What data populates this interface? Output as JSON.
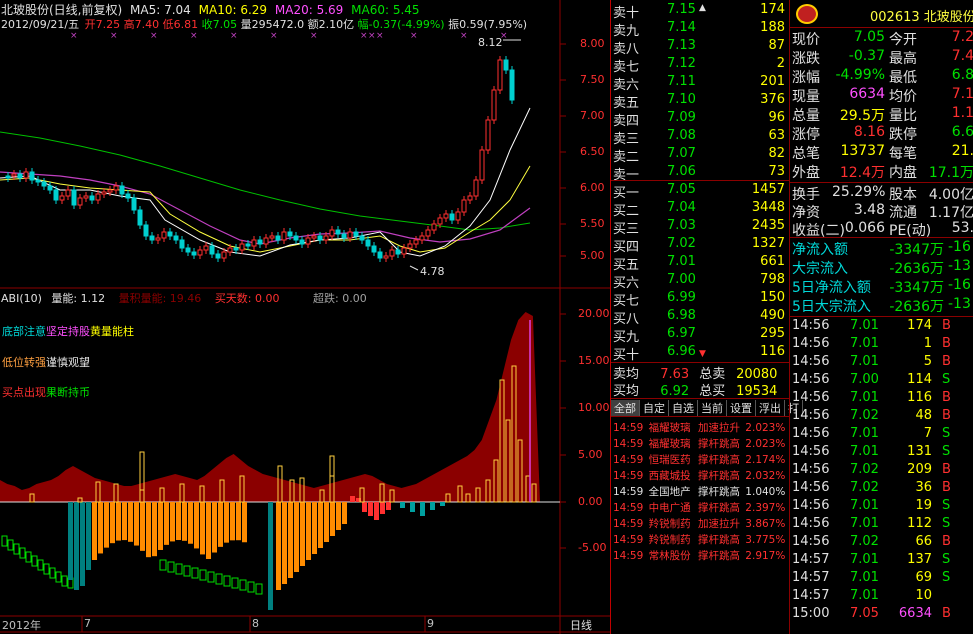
{
  "chart_header": {
    "stock": "北玻股份(日线,前复权)",
    "ma5": "MA5: 7.04",
    "ma10": "MA10: 6.29",
    "ma20": "MA20: 5.69",
    "ma60": "MA60: 5.45",
    "date_line": "2012/09/21/五",
    "open": "开7.25",
    "high": "高7.40",
    "low": "低6.81",
    "close": "收7.05",
    "vol": "量295472.0",
    "amount": "额2.10亿",
    "change": "幅-0.37(-4.99%)",
    "amplitude": "振0.59(7.95%)"
  },
  "price_axis": [
    "8.00",
    "7.50",
    "7.00",
    "6.50",
    "6.00",
    "5.50",
    "5.00"
  ],
  "high_mark": "8.12",
  "low_mark": "4.78",
  "indicator_header": {
    "name": "ABI(10)",
    "label1": "量能: 1.12",
    "label2": "量积量能: 19.46",
    "label3": "买天数: 0.00",
    "label4": "超跌: 0.00"
  },
  "indicator_axis": [
    "20.00",
    "15.00",
    "10.00",
    "5.00",
    "0.00",
    "-5.00"
  ],
  "indicator_notes": {
    "n1a": "底部注意",
    "n1b": "坚定持股",
    "n1c": "黄量能柱",
    "n2a": "低位转强",
    "n2b": "谨慎观望",
    "n3a": "买点出现",
    "n3b": "果断持币"
  },
  "time_axis": [
    "2012年",
    "7",
    "8",
    "9"
  ],
  "period_label": "日线",
  "quote_title": "002613 北玻股份",
  "sell_book": [
    {
      "label": "卖十",
      "price": "7.15",
      "vol": "174"
    },
    {
      "label": "卖九",
      "price": "7.14",
      "vol": "188"
    },
    {
      "label": "卖八",
      "price": "7.13",
      "vol": "87"
    },
    {
      "label": "卖七",
      "price": "7.12",
      "vol": "2"
    },
    {
      "label": "卖六",
      "price": "7.11",
      "vol": "201"
    },
    {
      "label": "卖五",
      "price": "7.10",
      "vol": "376"
    },
    {
      "label": "卖四",
      "price": "7.09",
      "vol": "96"
    },
    {
      "label": "卖三",
      "price": "7.08",
      "vol": "63"
    },
    {
      "label": "卖二",
      "price": "7.07",
      "vol": "82"
    },
    {
      "label": "卖一",
      "price": "7.06",
      "vol": "73"
    }
  ],
  "buy_book": [
    {
      "label": "买一",
      "price": "7.05",
      "vol": "1457"
    },
    {
      "label": "买二",
      "price": "7.04",
      "vol": "3448"
    },
    {
      "label": "买三",
      "price": "7.03",
      "vol": "2435"
    },
    {
      "label": "买四",
      "price": "7.02",
      "vol": "1327"
    },
    {
      "label": "买五",
      "price": "7.01",
      "vol": "661"
    },
    {
      "label": "买六",
      "price": "7.00",
      "vol": "798"
    },
    {
      "label": "买七",
      "price": "6.99",
      "vol": "150"
    },
    {
      "label": "买八",
      "price": "6.98",
      "vol": "490"
    },
    {
      "label": "买九",
      "price": "6.97",
      "vol": "295"
    },
    {
      "label": "买十",
      "price": "6.96",
      "vol": "116"
    }
  ],
  "avg": {
    "sell_avg_label": "卖均",
    "sell_avg": "7.63",
    "total_sell_label": "总卖",
    "total_sell": "20080",
    "buy_avg_label": "买均",
    "buy_avg": "6.92",
    "total_buy_label": "总买",
    "total_buy": "19534"
  },
  "stats": [
    {
      "l1": "现价",
      "v1": "7.05",
      "l2": "今开",
      "v2": "7.2"
    },
    {
      "l1": "涨跌",
      "v1": "-0.37",
      "l2": "最高",
      "v2": "7.4"
    },
    {
      "l1": "涨幅",
      "v1": "-4.99%",
      "l2": "最低",
      "v2": "6.8"
    },
    {
      "l1": "现量",
      "v1": "6634",
      "l2": "均价",
      "v2": "7.1"
    },
    {
      "l1": "总量",
      "v1": "29.5万",
      "l2": "量比",
      "v2": "1.1"
    },
    {
      "l1": "涨停",
      "v1": "8.16",
      "l2": "跌停",
      "v2": "6.6"
    },
    {
      "l1": "总笔",
      "v1": "13737",
      "l2": "每笔",
      "v2": "21."
    },
    {
      "l1": "外盘",
      "v1": "12.4万",
      "l2": "内盘",
      "v2": "17.1万"
    }
  ],
  "fin": [
    {
      "l1": "换手",
      "v1": "25.29%",
      "l2": "股本",
      "v2": "4.00亿"
    },
    {
      "l1": "净资",
      "v1": "3.48",
      "l2": "流通",
      "v2": "1.17亿"
    },
    {
      "l1": "收益(二)",
      "v1": "0.066",
      "l2": "PE(动)",
      "v2": "53."
    }
  ],
  "flows": [
    {
      "label": "净流入额",
      "v1": "-3347万",
      "v2": "-16"
    },
    {
      "label": "大宗流入",
      "v1": "-2636万",
      "v2": "-13"
    },
    {
      "label": "5日净流入额",
      "v1": "-3347万",
      "v2": "-16"
    },
    {
      "label": "5日大宗流入",
      "v1": "-2636万",
      "v2": "-13"
    }
  ],
  "tabs": [
    "全部",
    "自定",
    "自选",
    "当前",
    "设置",
    "浮出",
    "打"
  ],
  "alerts": [
    {
      "time": "14:59",
      "name": "福耀玻璃",
      "event": "加速拉升",
      "val": "2.023%"
    },
    {
      "time": "14:59",
      "name": "福耀玻璃",
      "event": "撑杆跳高",
      "val": "2.023%"
    },
    {
      "time": "14:59",
      "name": "恒瑞医药",
      "event": "撑杆跳高",
      "val": "2.174%"
    },
    {
      "time": "14:59",
      "name": "西藏城投",
      "event": "撑杆跳高",
      "val": "2.032%"
    },
    {
      "time": "14:59",
      "name": "全国地产",
      "event": "撑杆跳高",
      "val": "1.040%"
    },
    {
      "time": "14:59",
      "name": "中电广通",
      "event": "撑杆跳高",
      "val": "2.397%"
    },
    {
      "time": "14:59",
      "name": "羚锐制药",
      "event": "加速拉升",
      "val": "3.867%"
    },
    {
      "time": "14:59",
      "name": "羚锐制药",
      "event": "撑杆跳高",
      "val": "3.775%"
    },
    {
      "time": "14:59",
      "name": "常林股份",
      "event": "撑杆跳高",
      "val": "2.917%"
    }
  ],
  "ticks": [
    {
      "t": "14:56",
      "p": "7.01",
      "v": "174",
      "s": "B"
    },
    {
      "t": "14:56",
      "p": "7.01",
      "v": "1",
      "s": "B"
    },
    {
      "t": "14:56",
      "p": "7.01",
      "v": "5",
      "s": "B"
    },
    {
      "t": "14:56",
      "p": "7.00",
      "v": "114",
      "s": "S"
    },
    {
      "t": "14:56",
      "p": "7.01",
      "v": "116",
      "s": "B"
    },
    {
      "t": "14:56",
      "p": "7.02",
      "v": "48",
      "s": "B"
    },
    {
      "t": "14:56",
      "p": "7.01",
      "v": "7",
      "s": "S"
    },
    {
      "t": "14:56",
      "p": "7.01",
      "v": "131",
      "s": "S"
    },
    {
      "t": "14:56",
      "p": "7.02",
      "v": "209",
      "s": "B"
    },
    {
      "t": "14:56",
      "p": "7.02",
      "v": "36",
      "s": "B"
    },
    {
      "t": "14:56",
      "p": "7.01",
      "v": "19",
      "s": "S"
    },
    {
      "t": "14:56",
      "p": "7.01",
      "v": "112",
      "s": "S"
    },
    {
      "t": "14:56",
      "p": "7.02",
      "v": "66",
      "s": "B"
    },
    {
      "t": "14:57",
      "p": "7.01",
      "v": "137",
      "s": "S"
    },
    {
      "t": "14:57",
      "p": "7.01",
      "v": "69",
      "s": "S"
    },
    {
      "t": "14:57",
      "p": "7.01",
      "v": "10",
      "s": ""
    },
    {
      "t": "15:00",
      "p": "7.05",
      "v": "6634",
      "s": "B"
    }
  ],
  "colors": {
    "up": "#ff3030",
    "down": "#00e000",
    "flat": "#e0e0e0",
    "accent": "#ffff00",
    "frame": "#8b0000"
  }
}
